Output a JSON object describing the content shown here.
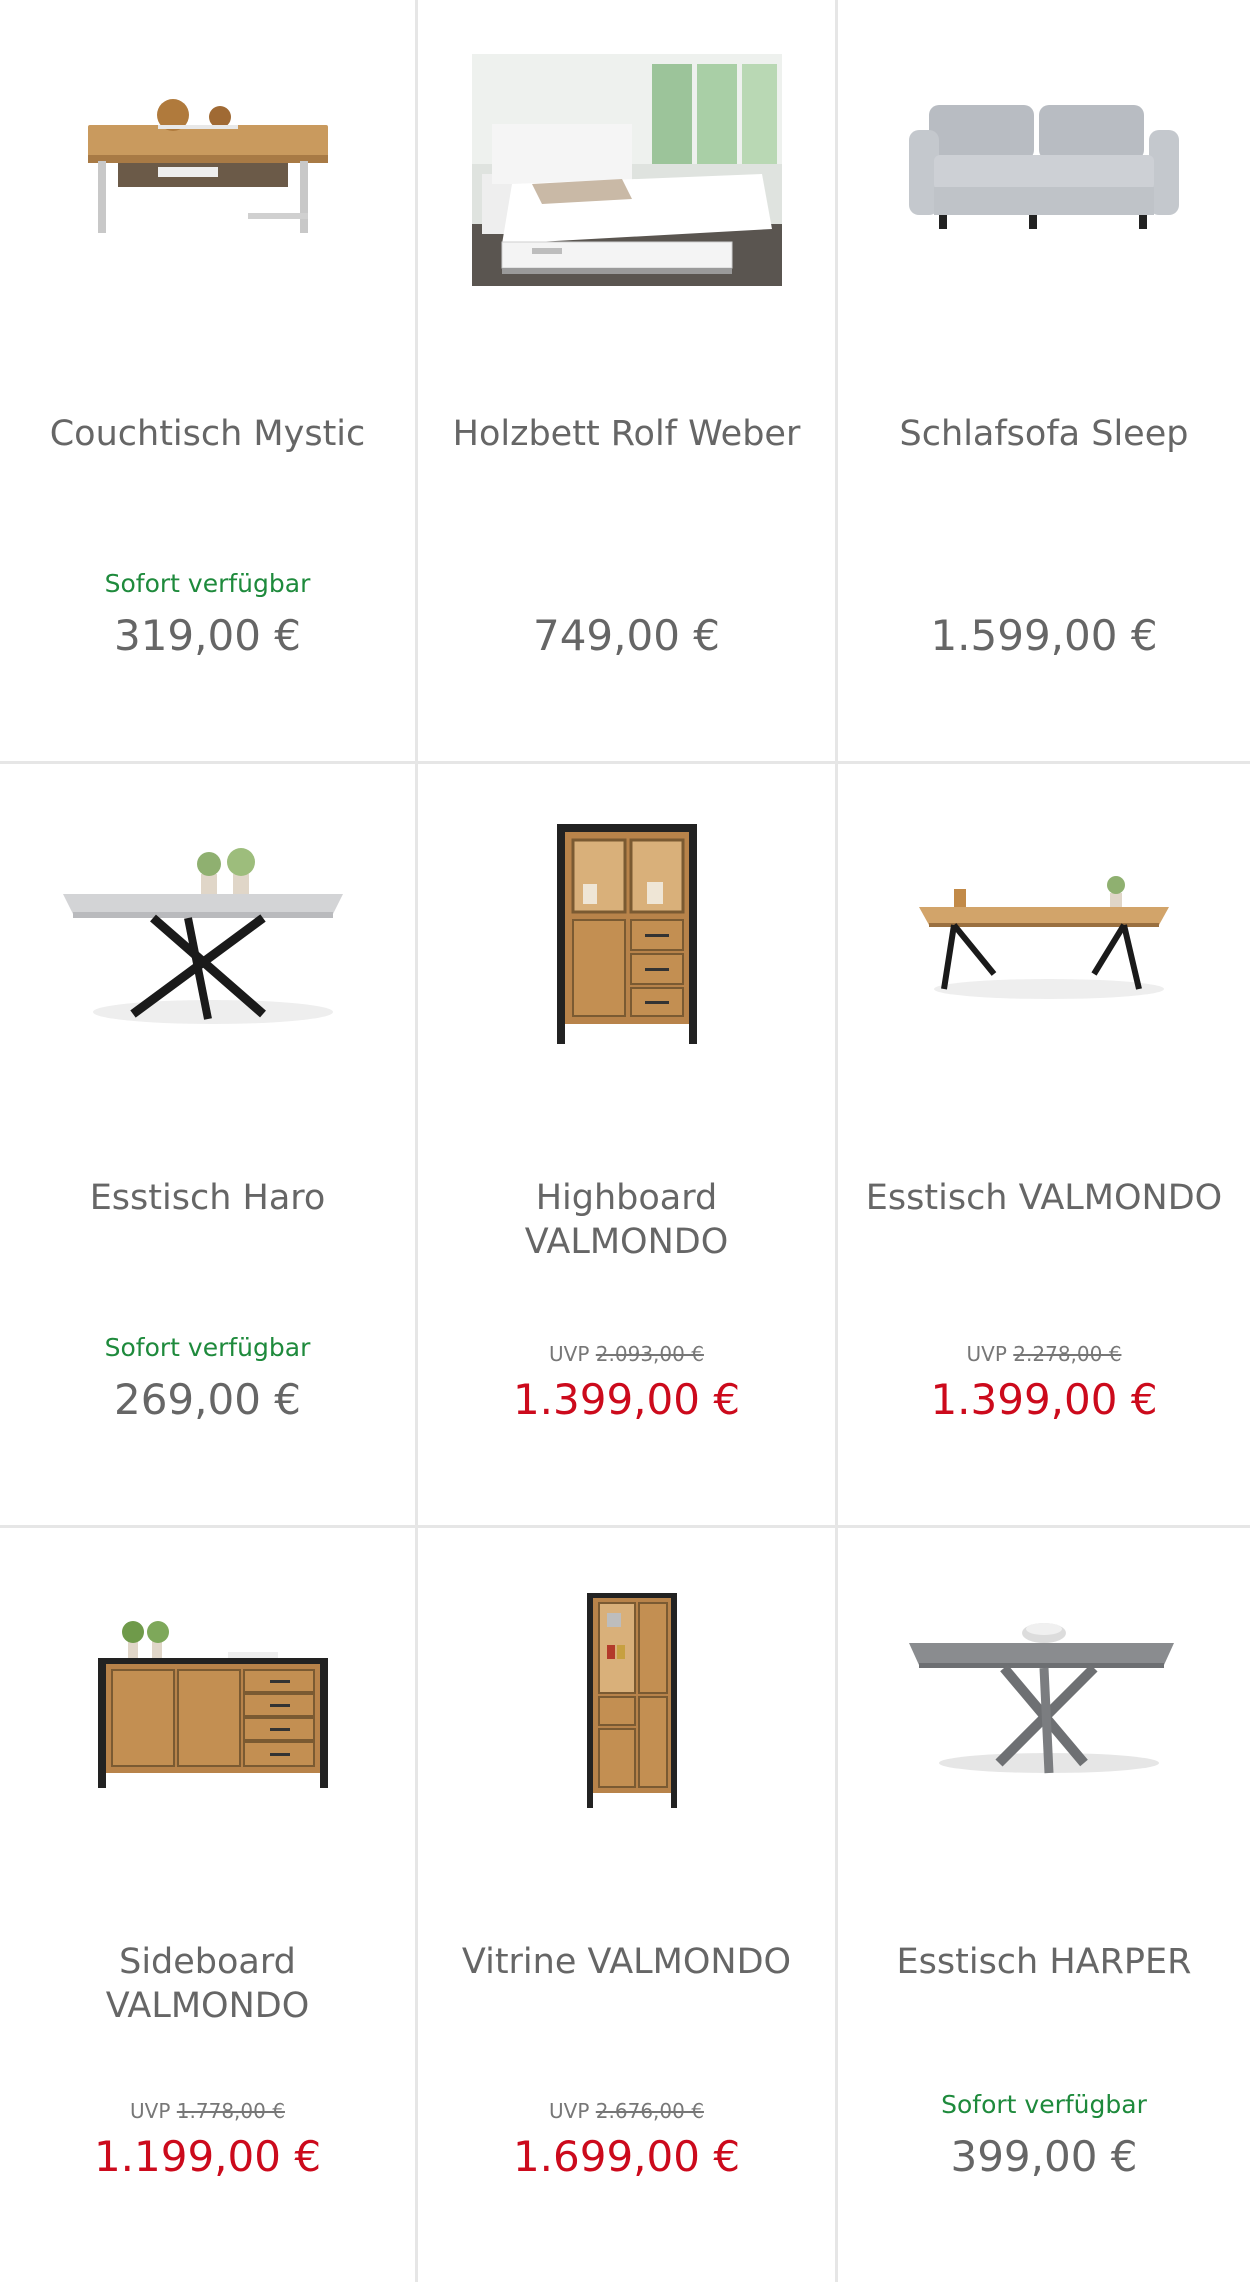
{
  "products": [
    {
      "title": "Couchtisch Mystic",
      "availability": "Sofort verfügbar",
      "price": "319,00 €",
      "uvp_label": "",
      "uvp_price": ""
    },
    {
      "title": "Holzbett Rolf Weber",
      "availability": "",
      "price": "749,00 €",
      "uvp_label": "",
      "uvp_price": ""
    },
    {
      "title": "Schlafsofa Sleep",
      "availability": "",
      "price": "1.599,00 €",
      "uvp_label": "",
      "uvp_price": ""
    },
    {
      "title": "Esstisch Haro",
      "availability": "Sofort verfügbar",
      "price": "269,00 €",
      "uvp_label": "",
      "uvp_price": ""
    },
    {
      "title": "Highboard VALMONDO",
      "availability": "",
      "price": "1.399,00 €",
      "uvp_label": "UVP",
      "uvp_price": "2.093,00 €"
    },
    {
      "title": "Esstisch VALMONDO",
      "availability": "",
      "price": "1.399,00 €",
      "uvp_label": "UVP",
      "uvp_price": "2.278,00 €"
    },
    {
      "title": "Sideboard VALMONDO",
      "availability": "",
      "price": "1.199,00 €",
      "uvp_label": "UVP",
      "uvp_price": "1.778,00 €"
    },
    {
      "title": "Vitrine VALMONDO",
      "availability": "",
      "price": "1.699,00 €",
      "uvp_label": "UVP",
      "uvp_price": "2.676,00 €"
    },
    {
      "title": "Esstisch HARPER",
      "availability": "Sofort verfügbar",
      "price": "399,00 €",
      "uvp_label": "",
      "uvp_price": ""
    }
  ],
  "icons": [
    "coffee-table-image",
    "wooden-bed-image",
    "sofa-bed-image",
    "dining-table-haro-image",
    "highboard-image",
    "dining-table-valmondo-image",
    "sideboard-image",
    "vitrine-image",
    "dining-table-harper-image"
  ],
  "colors": {
    "title": "#666666",
    "price": "#666666",
    "sale_price": "#cc0a1c",
    "availability": "#1e8a3c",
    "uvp": "#777777",
    "divider": "#e6e6e6"
  }
}
